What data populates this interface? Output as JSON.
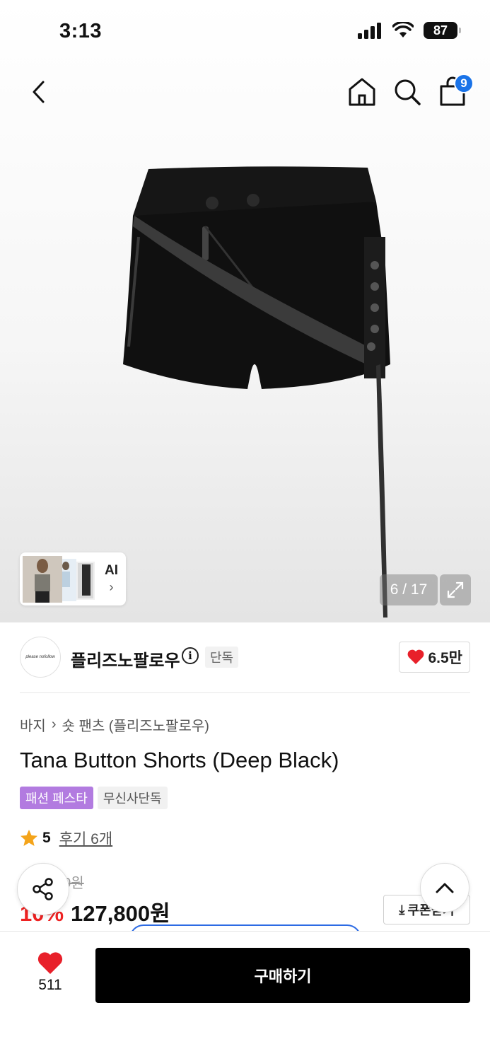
{
  "status_bar": {
    "time": "3:13",
    "battery": "87"
  },
  "nav": {
    "cart_count": "9"
  },
  "gallery": {
    "ai_label": "AI",
    "counter": "6 / 17"
  },
  "brand": {
    "logo_text": "please nofollow",
    "name": "플리즈노팔로우",
    "exclusive_tag": "단독",
    "likes": "6.5만"
  },
  "product": {
    "breadcrumb": [
      "바지",
      "숏 팬츠 (플리즈노팔로우)"
    ],
    "title": "Tana Button Shorts (Deep Black)",
    "tags": [
      "패션 페스타",
      "무신사단독"
    ],
    "rating": "5",
    "reviews": "후기 6개",
    "original_price": "142,000원",
    "discount": "10%",
    "sale_price": "127,800원",
    "coupon_label": "쿠폰받기"
  },
  "bottom_bar": {
    "wish_count": "511",
    "buy_label": "구매하기"
  },
  "colors": {
    "accent_blue": "#1a73e8",
    "discount_red": "#ee2222",
    "tag_purple": "#b27be0",
    "heart_red": "#e8202a"
  }
}
